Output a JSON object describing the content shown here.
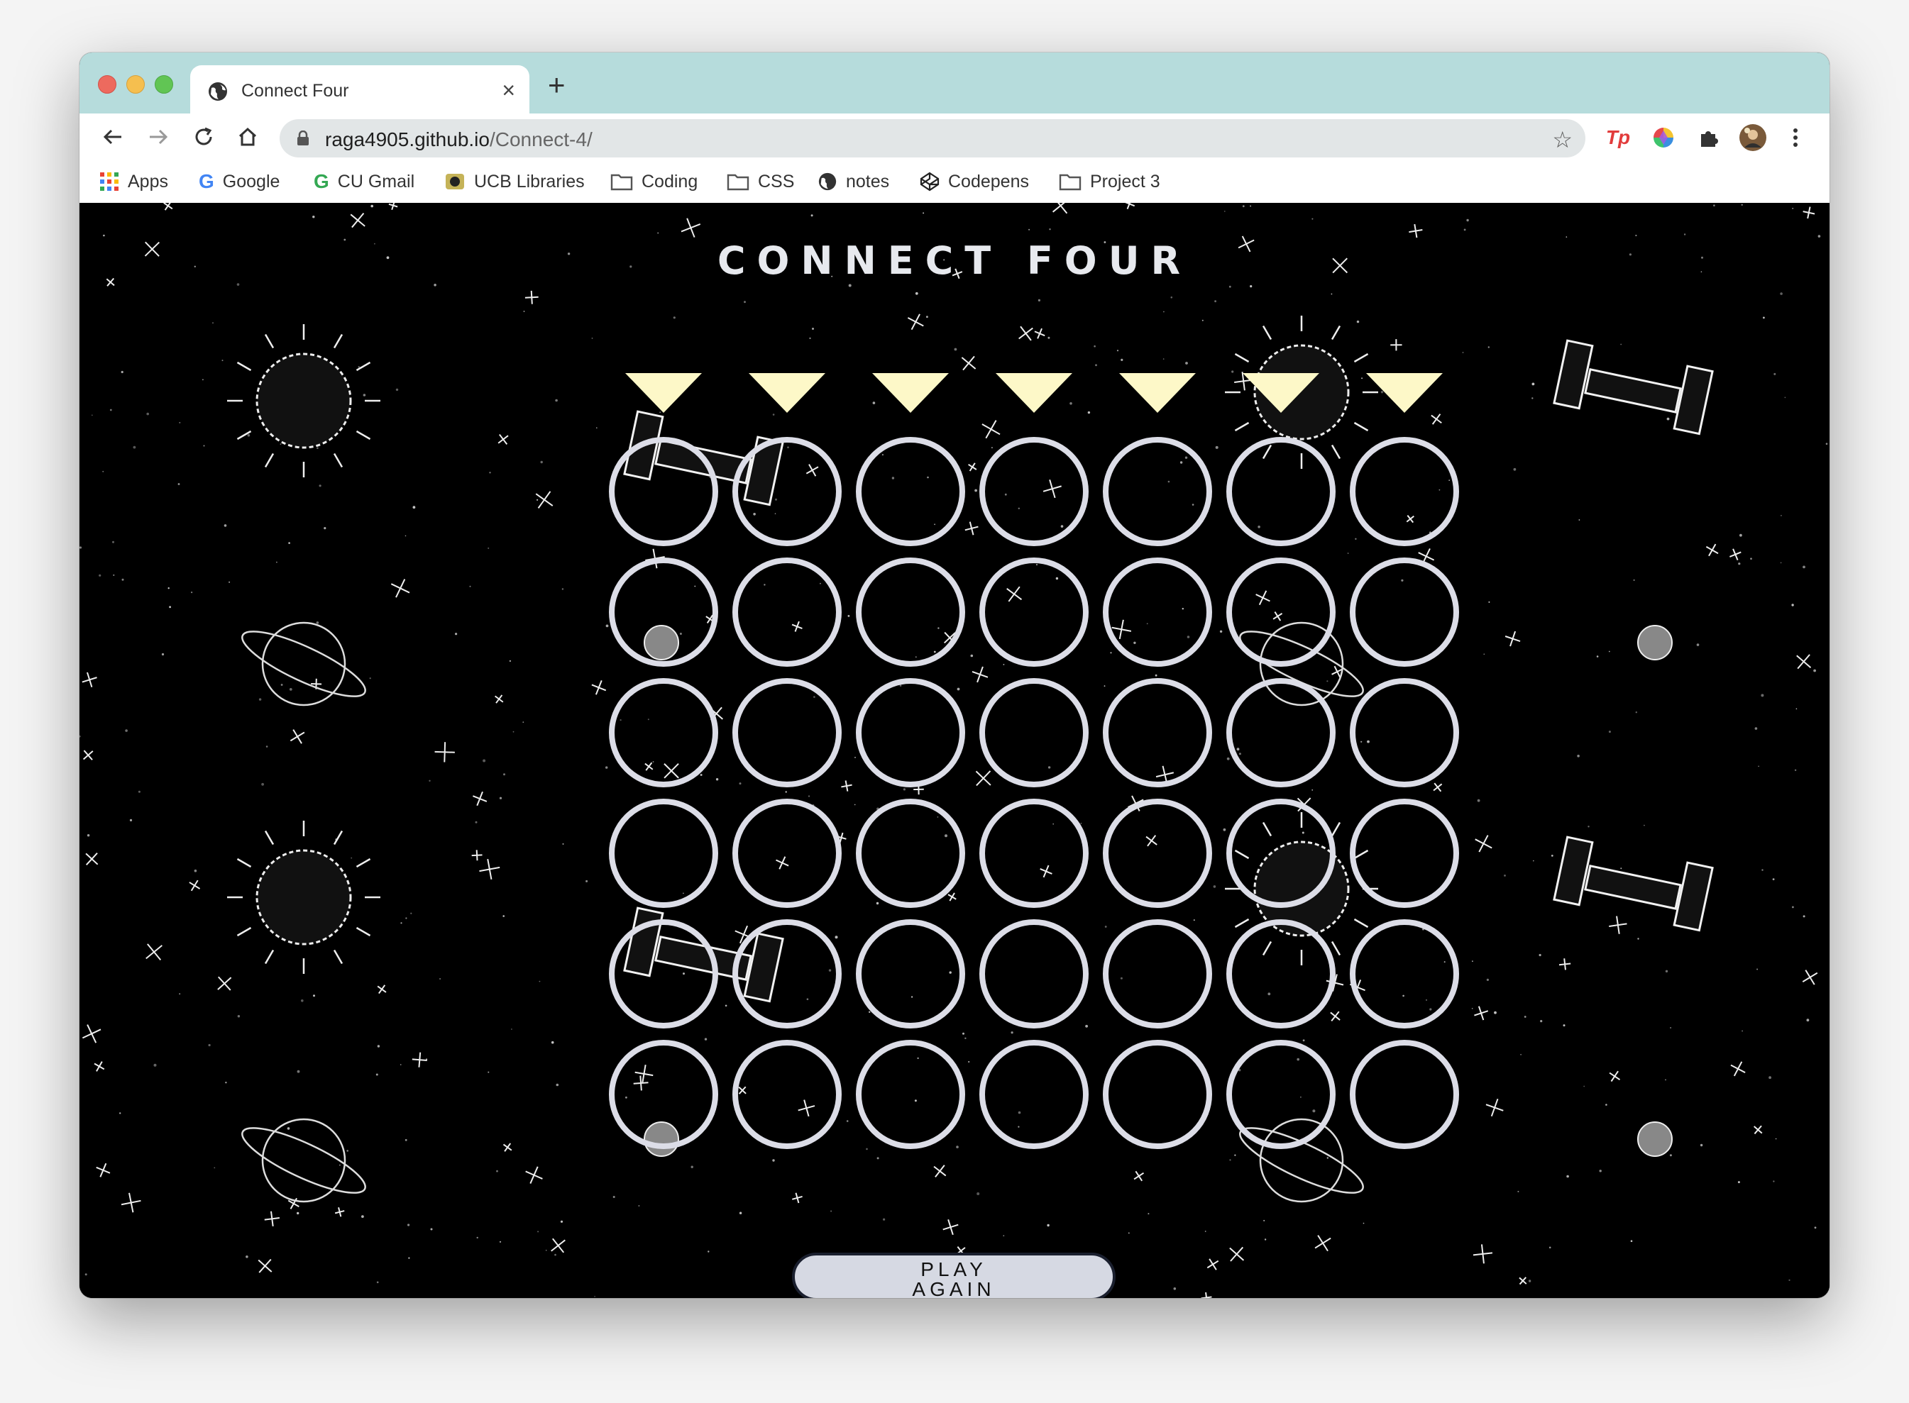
{
  "browser": {
    "tab_title": "Connect Four",
    "new_tab_symbol": "+",
    "close_symbol": "×",
    "url_host": "raga4905.github.io",
    "url_path": "/Connect-4/",
    "bookmarks": [
      {
        "label": "Apps",
        "icon": "apps-grid-icon"
      },
      {
        "label": "Google",
        "icon": "google-g-icon"
      },
      {
        "label": "CU Gmail",
        "icon": "google-g-icon"
      },
      {
        "label": "UCB Libraries",
        "icon": "buff-logo-icon"
      },
      {
        "label": "Coding",
        "icon": "folder-icon"
      },
      {
        "label": "CSS",
        "icon": "folder-icon"
      },
      {
        "label": "notes",
        "icon": "globe-icon"
      },
      {
        "label": "Codepens",
        "icon": "codepen-icon"
      },
      {
        "label": "Project 3",
        "icon": "folder-icon"
      }
    ],
    "extensions": [
      "tp-extension-icon",
      "color-wheel-extension-icon",
      "puzzle-extensions-icon",
      "profile-avatar"
    ]
  },
  "game": {
    "title": "CONNECT FOUR",
    "columns": 7,
    "rows": 6,
    "drop_arrow_color": "#fdf8c8",
    "cell_ring_color": "#dcdde7",
    "board_state": [
      [
        "empty",
        "empty",
        "empty",
        "empty",
        "empty",
        "empty",
        "empty"
      ],
      [
        "empty",
        "empty",
        "empty",
        "empty",
        "empty",
        "empty",
        "empty"
      ],
      [
        "empty",
        "empty",
        "empty",
        "empty",
        "empty",
        "empty",
        "empty"
      ],
      [
        "empty",
        "empty",
        "empty",
        "empty",
        "empty",
        "empty",
        "empty"
      ],
      [
        "empty",
        "empty",
        "empty",
        "empty",
        "empty",
        "empty",
        "empty"
      ],
      [
        "empty",
        "empty",
        "empty",
        "empty",
        "empty",
        "empty",
        "empty"
      ]
    ],
    "play_again_line1": "PLAY",
    "play_again_line2": "AGAIN"
  },
  "theme": {
    "tabstrip_bg": "#b6dcdc",
    "page_bg": "#000000"
  }
}
